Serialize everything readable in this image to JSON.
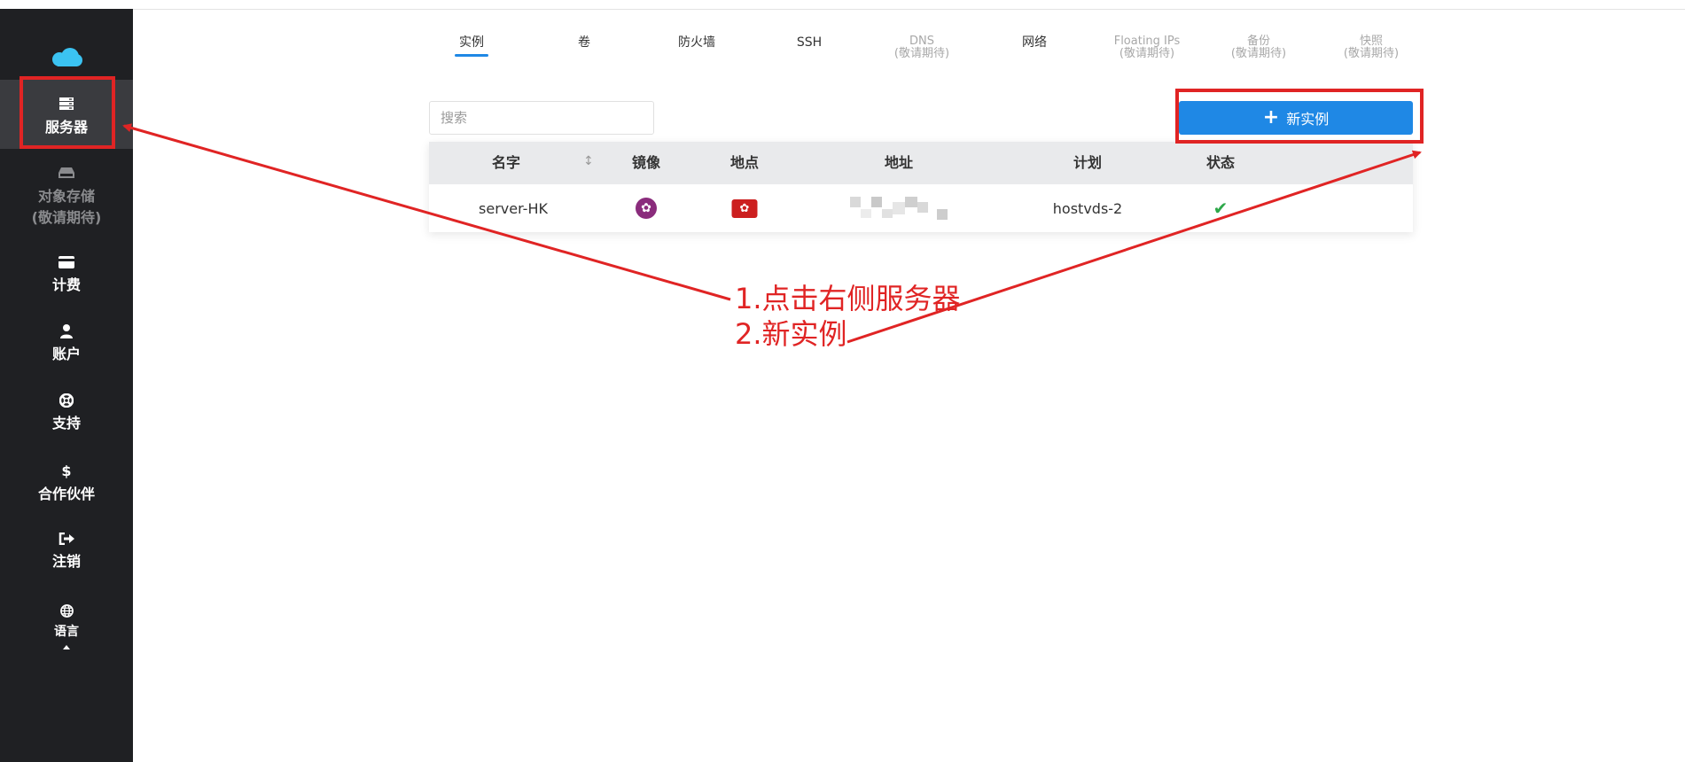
{
  "sidebar": {
    "items": [
      {
        "label": "服务器",
        "sub": "",
        "icon": "server-icon",
        "active": true,
        "disabled": false
      },
      {
        "label": "对象存储",
        "sub": "(敬请期待)",
        "icon": "storage-icon",
        "active": false,
        "disabled": true
      },
      {
        "label": "计费",
        "sub": "",
        "icon": "credit-card-icon",
        "active": false,
        "disabled": false
      },
      {
        "label": "账户",
        "sub": "",
        "icon": "user-icon",
        "active": false,
        "disabled": false
      },
      {
        "label": "支持",
        "sub": "",
        "icon": "lifebuoy-icon",
        "active": false,
        "disabled": false
      },
      {
        "label": "合作伙伴",
        "sub": "",
        "icon": "dollar-icon",
        "active": false,
        "disabled": false
      },
      {
        "label": "注销",
        "sub": "",
        "icon": "sign-out-icon",
        "active": false,
        "disabled": false
      },
      {
        "label": "语言",
        "sub": "",
        "icon": "globe-icon",
        "active": false,
        "disabled": false
      }
    ]
  },
  "tabs": [
    {
      "label": "实例",
      "sub": "",
      "active": true,
      "disabled": false
    },
    {
      "label": "卷",
      "sub": "",
      "active": false,
      "disabled": false
    },
    {
      "label": "防火墙",
      "sub": "",
      "active": false,
      "disabled": false
    },
    {
      "label": "SSH",
      "sub": "",
      "active": false,
      "disabled": false
    },
    {
      "label": "DNS",
      "sub": "(敬请期待)",
      "active": false,
      "disabled": true
    },
    {
      "label": "网络",
      "sub": "",
      "active": false,
      "disabled": false
    },
    {
      "label": "Floating IPs",
      "sub": "(敬请期待)",
      "active": false,
      "disabled": true
    },
    {
      "label": "备份",
      "sub": "(敬请期待)",
      "active": false,
      "disabled": true
    },
    {
      "label": "快照",
      "sub": "(敬请期待)",
      "active": false,
      "disabled": true
    }
  ],
  "search": {
    "placeholder": "搜索",
    "value": ""
  },
  "new_instance_button": {
    "plus": "+",
    "label": "新实例"
  },
  "table": {
    "headers": [
      "名字",
      "镜像",
      "地点",
      "地址",
      "计划",
      "状态"
    ],
    "sort_icon": "sort-icon",
    "rows": [
      {
        "name": "server-HK",
        "image_icon": "os-logo-icon",
        "location_icon": "hong-kong-flag-icon",
        "address": "",
        "plan": "hostvds-2",
        "status_icon": "check-icon"
      }
    ]
  },
  "annotation": {
    "line1": "1.点击右侧服务器",
    "line2": "2.新实例",
    "color": "#e02424"
  },
  "colors": {
    "accent": "#1f88e5",
    "sidebar_bg": "#1f2023",
    "success": "#2ea84a"
  }
}
